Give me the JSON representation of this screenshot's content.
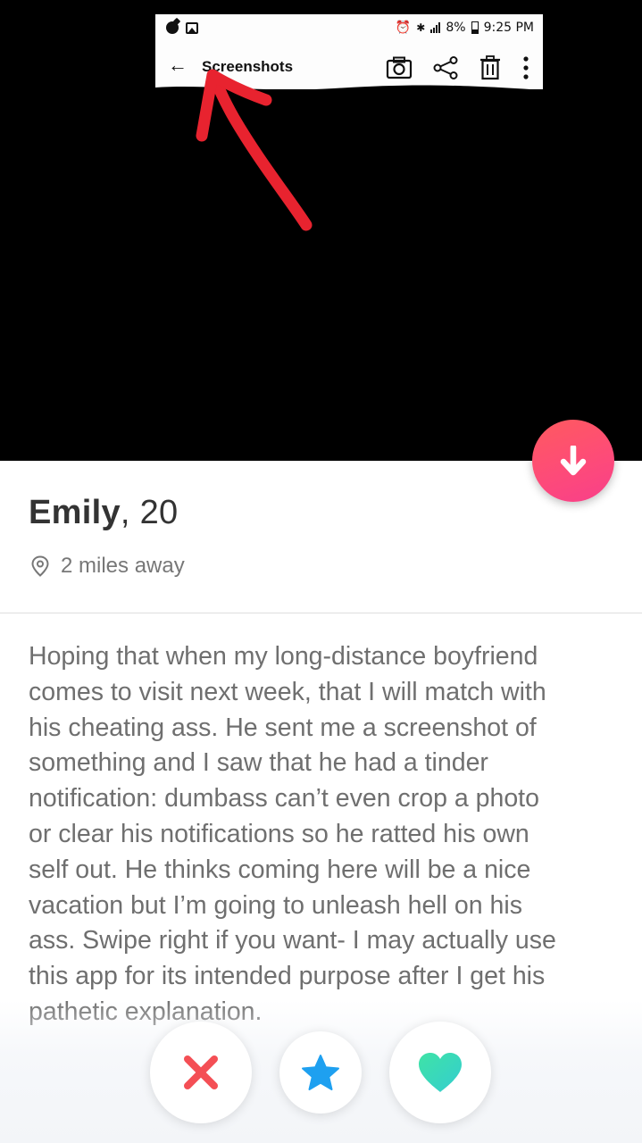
{
  "photo": {
    "screenshot_status": {
      "battery": "8%",
      "time": "9:25 PM"
    },
    "screenshot_toolbar": {
      "back_glyph": "←",
      "title": "Screenshots",
      "icons": [
        "camera-icon",
        "share-icon",
        "trash-icon",
        "more-vert-icon"
      ]
    },
    "annotation": "red-arrow"
  },
  "colors": {
    "brand_gradient_start": "#ff5a5f",
    "brand_gradient_end": "#f83f8a",
    "nope": "#f44f55",
    "super_like": "#1ea0f0",
    "like": "#3fdcb0"
  },
  "profile": {
    "name": "Emily",
    "age_text": ", 20",
    "distance": "2 miles away",
    "bio": "Hoping that when my long-distance boyfriend\ncomes to visit next week, that I will match with\nhis cheating ass. He sent me a screenshot of\nsomething and I saw that he had a tinder\nnotification: dumbass can’t even crop a photo\nor clear his notifications so he ratted his own\nself out. He thinks coming here will be a nice\nvacation but I’m going to unleash hell on his\nass. Swipe right if you want- I may actually use\nthis app for its intended purpose after I get his\npathetic explanation."
  },
  "actions": {
    "collapse": "arrow-down-icon",
    "nope": "x-icon",
    "super_like": "star-icon",
    "like": "heart-icon"
  }
}
